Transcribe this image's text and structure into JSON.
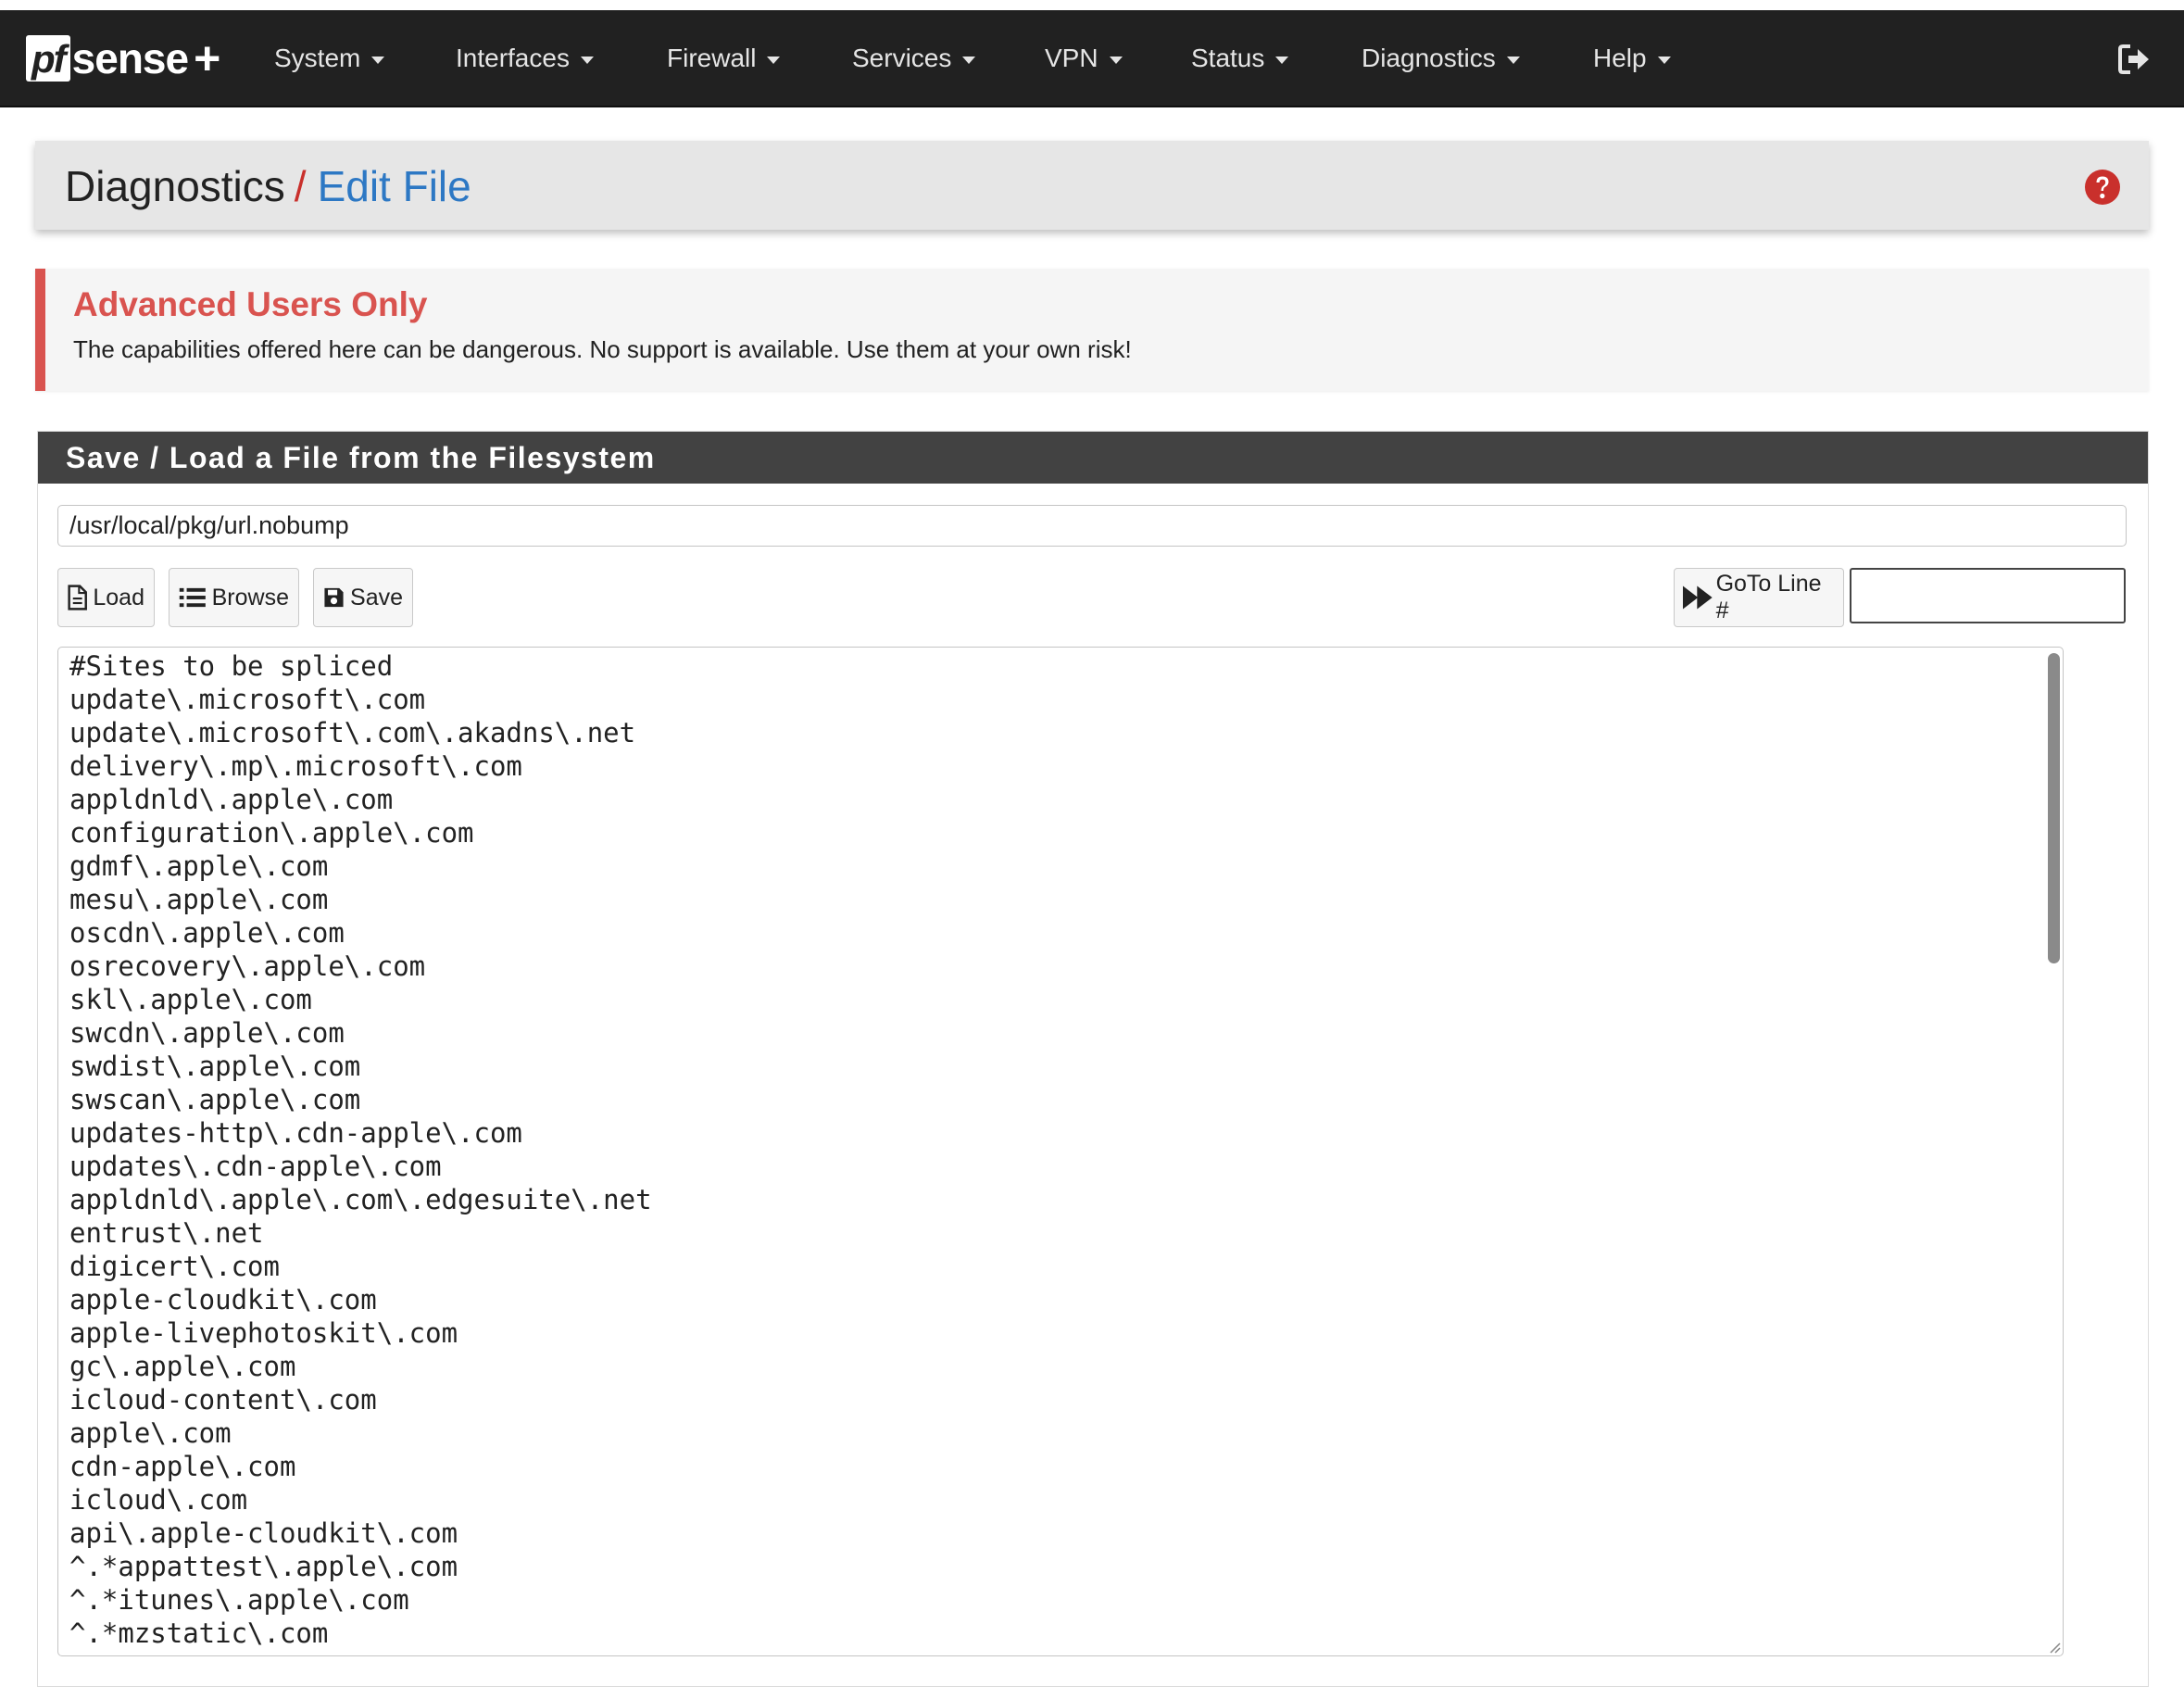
{
  "brand": {
    "pf": "pf",
    "sense": "sense",
    "plus": "+"
  },
  "nav": {
    "items": [
      {
        "label": "System"
      },
      {
        "label": "Interfaces"
      },
      {
        "label": "Firewall"
      },
      {
        "label": "Services"
      },
      {
        "label": "VPN"
      },
      {
        "label": "Status"
      },
      {
        "label": "Diagnostics"
      },
      {
        "label": "Help"
      }
    ]
  },
  "breadcrumb": {
    "section": "Diagnostics",
    "separator": "/",
    "page": "Edit File"
  },
  "alert": {
    "title": "Advanced Users Only",
    "message": "The capabilities offered here can be dangerous. No support is available. Use them at your own risk!"
  },
  "panel": {
    "heading": "Save / Load a File from the Filesystem",
    "file_path": "/usr/local/pkg/url.nobump",
    "buttons": {
      "load": "Load",
      "browse": "Browse",
      "save": "Save",
      "goto": "GoTo Line #"
    },
    "goto_value": ""
  },
  "editor": {
    "content": "#Sites to be spliced\nupdate\\.microsoft\\.com\nupdate\\.microsoft\\.com\\.akadns\\.net\ndelivery\\.mp\\.microsoft\\.com\nappldnld\\.apple\\.com\nconfiguration\\.apple\\.com\ngdmf\\.apple\\.com\nmesu\\.apple\\.com\noscdn\\.apple\\.com\nosrecovery\\.apple\\.com\nskl\\.apple\\.com\nswcdn\\.apple\\.com\nswdist\\.apple\\.com\nswscan\\.apple\\.com\nupdates-http\\.cdn-apple\\.com\nupdates\\.cdn-apple\\.com\nappldnld\\.apple\\.com\\.edgesuite\\.net\nentrust\\.net\ndigicert\\.com\napple-cloudkit\\.com\napple-livephotoskit\\.com\ngc\\.apple\\.com\nicloud-content\\.com\napple\\.com\ncdn-apple\\.com\nicloud\\.com\napi\\.apple-cloudkit\\.com\n^.*appattest\\.apple\\.com\n^.*itunes\\.apple\\.com\n^.*mzstatic\\.com"
  },
  "colors": {
    "navbar": "#212121",
    "accent_link": "#2d78c4",
    "danger": "#d9534f",
    "panel_heading": "#424242"
  },
  "icons": [
    "logout-icon",
    "help-icon",
    "file-icon",
    "list-icon",
    "floppy-icon",
    "fast-forward-icon",
    "caret-down-icon"
  ]
}
